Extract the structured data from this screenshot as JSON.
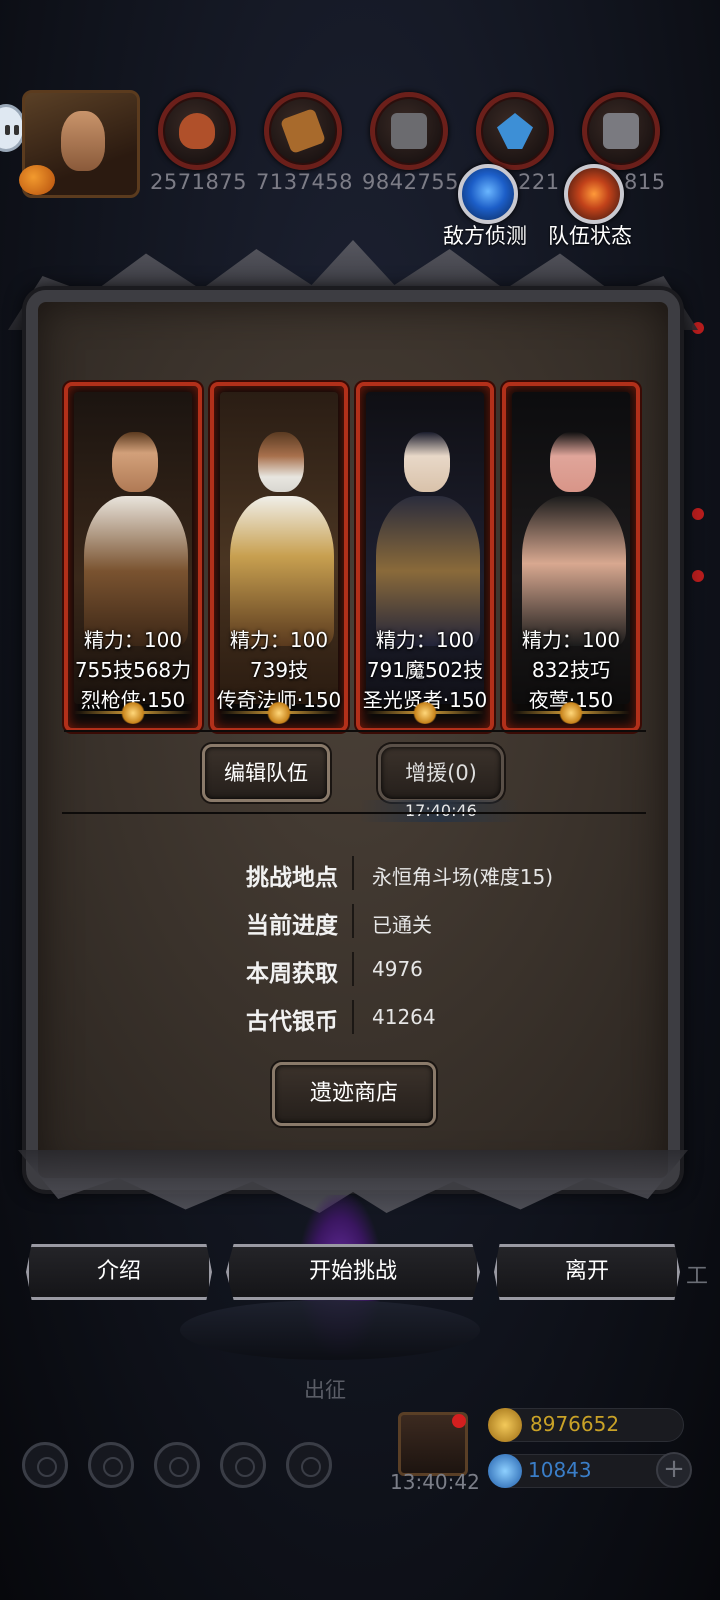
{
  "resources": [
    {
      "icon": "meat-icon",
      "value": "2571875",
      "color": "#b0502a"
    },
    {
      "icon": "wood-icon",
      "value": "7137458",
      "color": "#a86a2c"
    },
    {
      "icon": "stone-icon",
      "value": "9842755",
      "color": "#6b6b6f"
    },
    {
      "icon": "crystal-icon",
      "value": "221",
      "color": "#3d8fd6"
    },
    {
      "icon": "iron-icon",
      "value": "815",
      "color": "#7a7a80"
    }
  ],
  "top_buttons": {
    "enemy_scout": "敌方侦测",
    "team_status": "队伍状态"
  },
  "heroes": [
    {
      "energy": "精力：100",
      "power": "755技568力",
      "class_level": "烈枪侠·150"
    },
    {
      "energy": "精力：100",
      "power": "739技",
      "class_level": "传奇法师·150"
    },
    {
      "energy": "精力：100",
      "power": "791魔502技",
      "class_level": "圣光贤者·150"
    },
    {
      "energy": "精力：100",
      "power": "832技巧",
      "class_level": "夜莺·150"
    }
  ],
  "team": {
    "edit_label": "编辑队伍",
    "reinforce_label": "增援(0)",
    "reinforce_timer": "17:40:46"
  },
  "info": [
    {
      "label": "挑战地点",
      "value": "永恒角斗场(难度15)"
    },
    {
      "label": "当前进度",
      "value": "已通关"
    },
    {
      "label": "本周获取",
      "value": "4976"
    },
    {
      "label": "古代银币",
      "value": "41264"
    }
  ],
  "shop_label": "遗迹商店",
  "actions": {
    "intro": "介绍",
    "start": "开始挑战",
    "leave": "离开"
  },
  "background": {
    "expedition": "出征",
    "gift_timer": "13:40:42",
    "gold": "8976652",
    "gems": "10843",
    "right_edge": "工"
  },
  "colors": {
    "card_border": "#b2301a",
    "gold_text": "#c9a227",
    "gem_text": "#3a7ec8"
  }
}
